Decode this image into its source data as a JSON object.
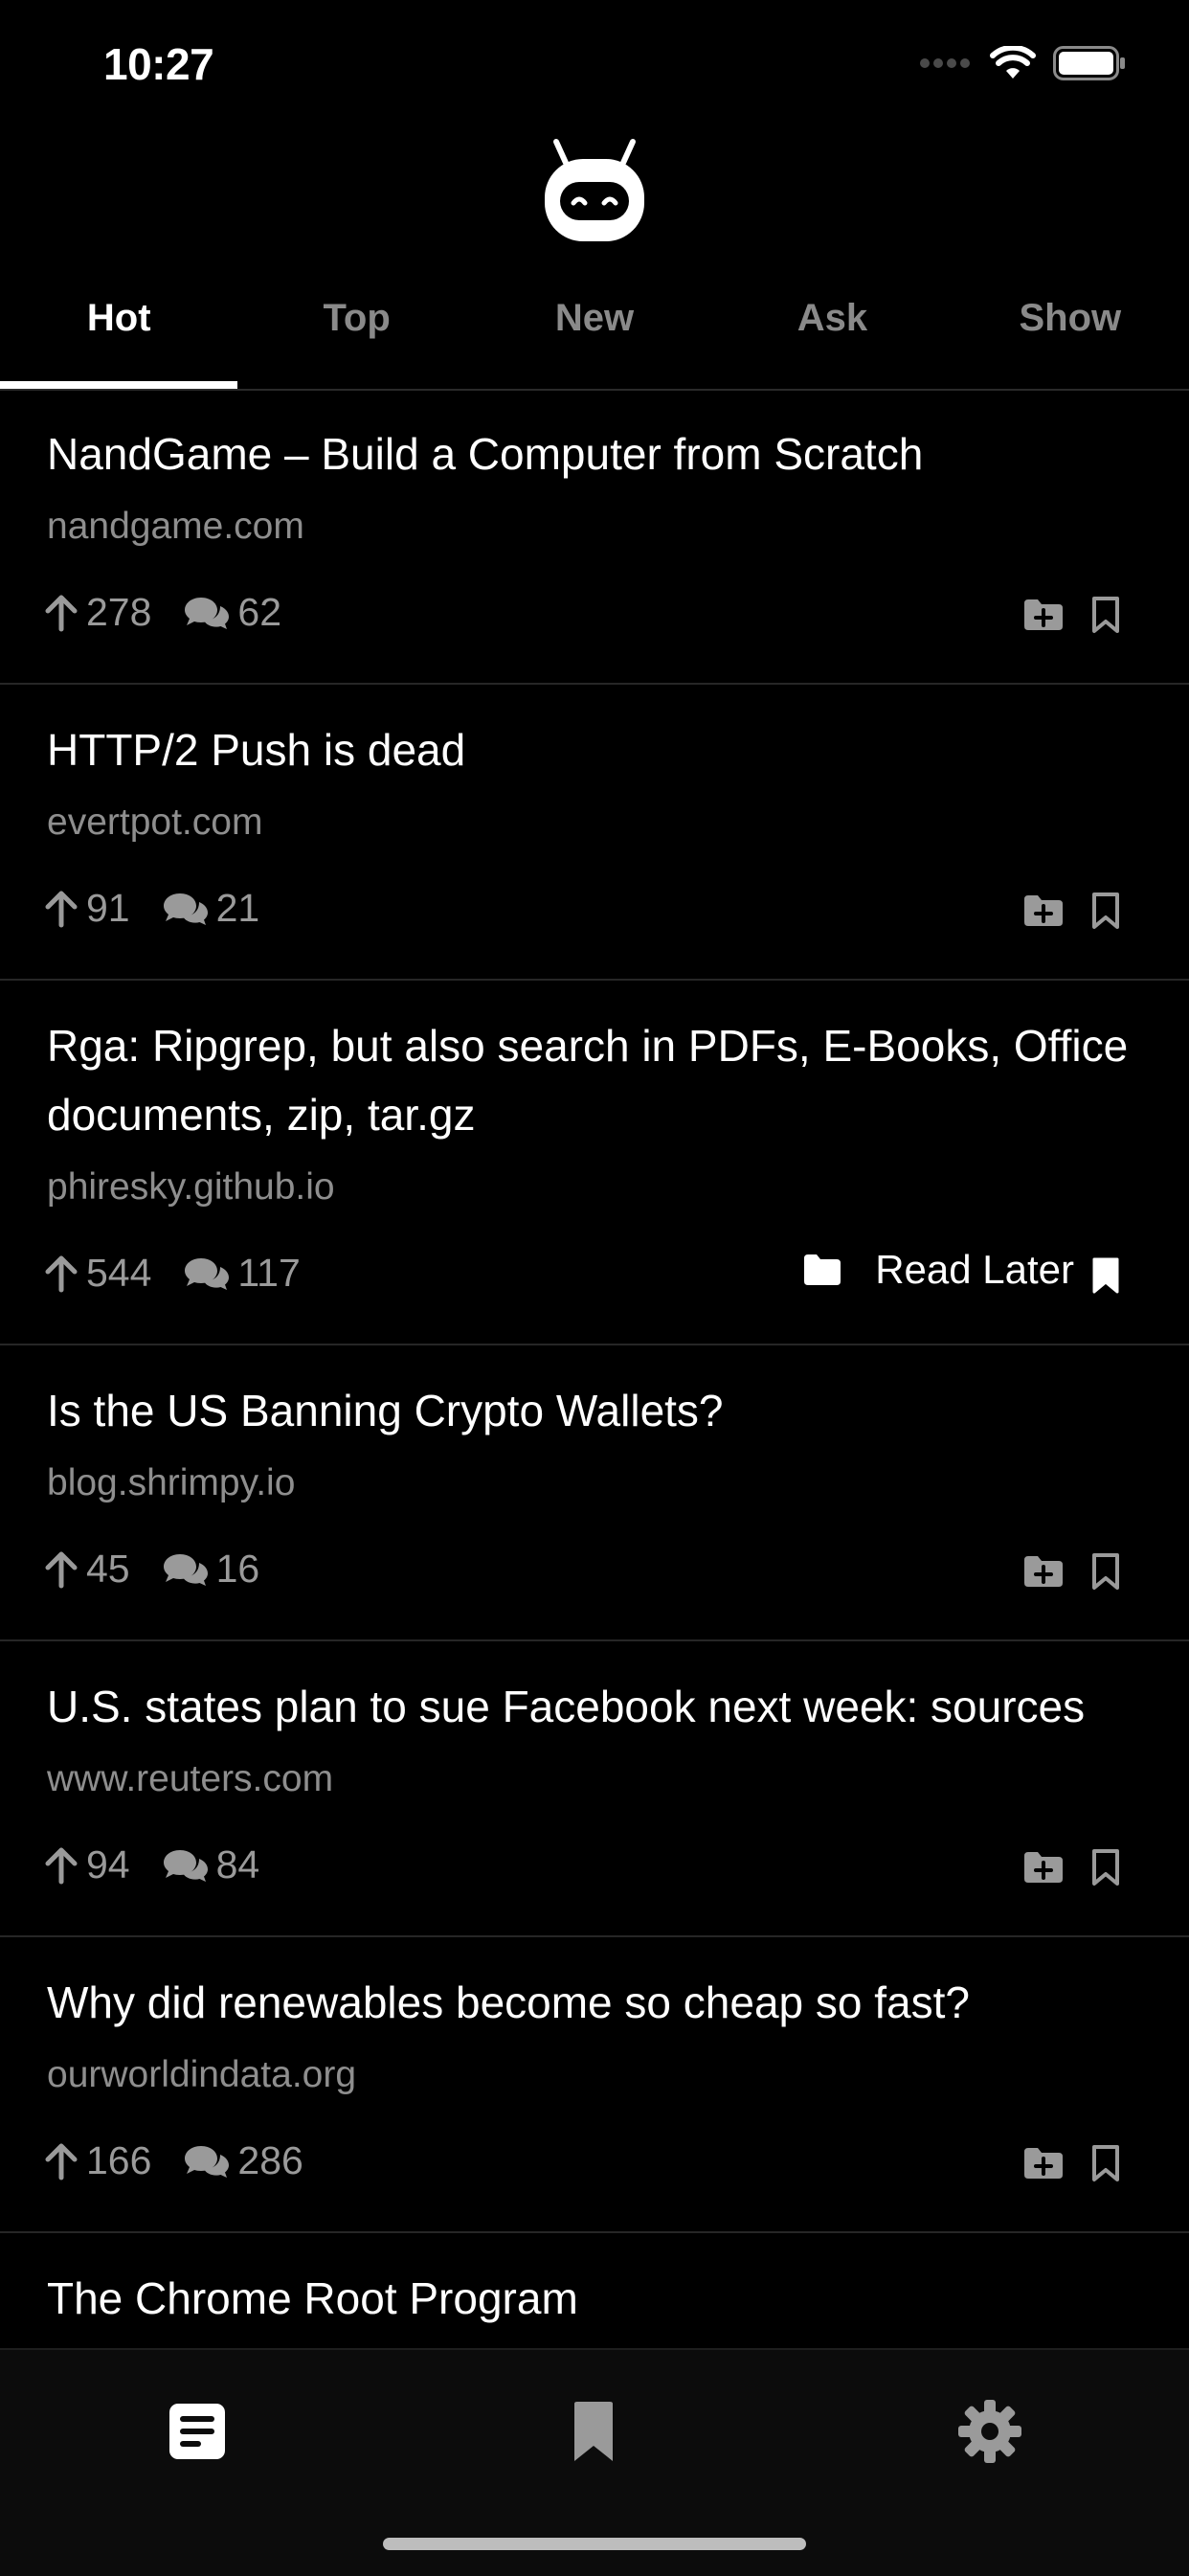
{
  "status_bar": {
    "time": "10:27"
  },
  "tabs": [
    {
      "label": "Hot",
      "active": true
    },
    {
      "label": "Top",
      "active": false
    },
    {
      "label": "New",
      "active": false
    },
    {
      "label": "Ask",
      "active": false
    },
    {
      "label": "Show",
      "active": false
    }
  ],
  "stories": [
    {
      "title": "NandGame – Build a Computer from Scratch",
      "domain": "nandgame.com",
      "points": "278",
      "comments": "62",
      "saved": false
    },
    {
      "title": "HTTP/2 Push is dead",
      "domain": "evertpot.com",
      "points": "91",
      "comments": "21",
      "saved": false
    },
    {
      "title": "Rga: Ripgrep, but also search in PDFs, E-Books, Office documents, zip, tar.gz",
      "domain": "phiresky.github.io",
      "points": "544",
      "comments": "117",
      "saved": true,
      "saved_label": "Read Later"
    },
    {
      "title": "Is the US Banning Crypto Wallets?",
      "domain": "blog.shrimpy.io",
      "points": "45",
      "comments": "16",
      "saved": false
    },
    {
      "title": "U.S. states plan to sue Facebook next week: sources",
      "domain": "www.reuters.com",
      "points": "94",
      "comments": "84",
      "saved": false
    },
    {
      "title": "Why did renewables become so cheap so fast?",
      "domain": "ourworldindata.org",
      "points": "166",
      "comments": "286",
      "saved": false
    },
    {
      "title": "The Chrome Root Program"
    }
  ],
  "bottom_nav": [
    {
      "icon": "news-feed-icon",
      "active": true
    },
    {
      "icon": "bookmark-icon",
      "active": false
    },
    {
      "icon": "gear-icon",
      "active": false
    }
  ]
}
